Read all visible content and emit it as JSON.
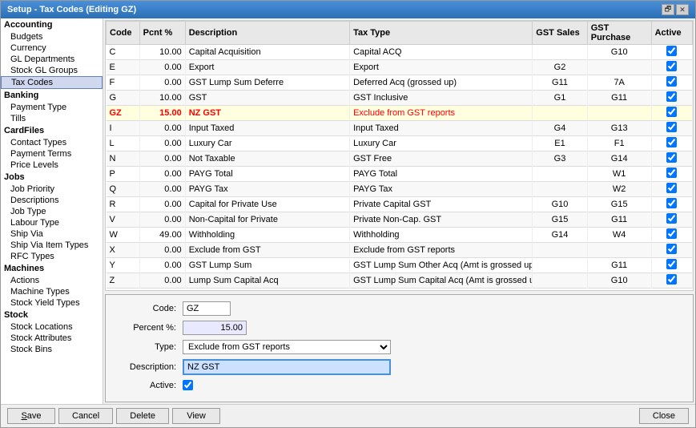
{
  "window": {
    "title": "Setup - Tax Codes (Editing GZ)",
    "restore_btn": "🗗",
    "close_btn": "✕"
  },
  "sidebar": {
    "sections": [
      {
        "header": "Accounting",
        "items": [
          {
            "label": "Budgets",
            "id": "budgets"
          },
          {
            "label": "Currency",
            "id": "currency"
          },
          {
            "label": "GL Departments",
            "id": "gl-departments"
          },
          {
            "label": "Stock GL Groups",
            "id": "stock-gl-groups"
          },
          {
            "label": "Tax Codes",
            "id": "tax-codes",
            "active": true
          }
        ]
      },
      {
        "header": "Banking",
        "items": [
          {
            "label": "Payment Type",
            "id": "payment-type"
          },
          {
            "label": "Tills",
            "id": "tills"
          }
        ]
      },
      {
        "header": "CardFiles",
        "items": [
          {
            "label": "Contact Types",
            "id": "contact-types"
          },
          {
            "label": "Payment Terms",
            "id": "payment-terms"
          },
          {
            "label": "Price Levels",
            "id": "price-levels"
          }
        ]
      },
      {
        "header": "Jobs",
        "items": [
          {
            "label": "Job Priority",
            "id": "job-priority"
          },
          {
            "label": "Descriptions",
            "id": "descriptions"
          },
          {
            "label": "Job Type",
            "id": "job-type"
          },
          {
            "label": "Labour Type",
            "id": "labour-type"
          },
          {
            "label": "Ship Via",
            "id": "ship-via"
          },
          {
            "label": "Ship Via Item Types",
            "id": "ship-via-item-types"
          },
          {
            "label": "RFC Types",
            "id": "rfc-types"
          }
        ]
      },
      {
        "header": "Machines",
        "items": [
          {
            "label": "Actions",
            "id": "actions"
          },
          {
            "label": "Machine Types",
            "id": "machine-types"
          },
          {
            "label": "Stock Yield Types",
            "id": "stock-yield-types"
          }
        ]
      },
      {
        "header": "Stock",
        "items": [
          {
            "label": "Stock Locations",
            "id": "stock-locations"
          },
          {
            "label": "Stock Attributes",
            "id": "stock-attributes"
          },
          {
            "label": "Stock Bins",
            "id": "stock-bins"
          }
        ]
      }
    ]
  },
  "table": {
    "columns": [
      "Code",
      "Pcnt %",
      "Description",
      "Tax Type",
      "GST Sales",
      "GST Purchase",
      "Active"
    ],
    "rows": [
      {
        "code": "C",
        "pcnt": "10.00",
        "desc": "Capital Acquisition",
        "taxtype": "Capital ACQ",
        "gstsales": "",
        "gstpurchase": "G10",
        "active": true,
        "selected": false
      },
      {
        "code": "E",
        "pcnt": "0.00",
        "desc": "Export",
        "taxtype": "Export",
        "gstsales": "G2",
        "gstpurchase": "",
        "active": true,
        "selected": false
      },
      {
        "code": "F",
        "pcnt": "0.00",
        "desc": "GST Lump Sum Deferre",
        "taxtype": "Deferred Acq (grossed up)",
        "gstsales": "G11",
        "gstpurchase": "7A",
        "active": true,
        "selected": false
      },
      {
        "code": "G",
        "pcnt": "10.00",
        "desc": "GST",
        "taxtype": "GST Inclusive",
        "gstsales": "G1",
        "gstpurchase": "G11",
        "active": true,
        "selected": false
      },
      {
        "code": "GZ",
        "pcnt": "15.00",
        "desc": "NZ GST",
        "taxtype": "Exclude from GST reports",
        "gstsales": "",
        "gstpurchase": "",
        "active": true,
        "selected": true
      },
      {
        "code": "I",
        "pcnt": "0.00",
        "desc": "Input Taxed",
        "taxtype": "Input Taxed",
        "gstsales": "G4",
        "gstpurchase": "G13",
        "active": true,
        "selected": false
      },
      {
        "code": "L",
        "pcnt": "0.00",
        "desc": "Luxury Car",
        "taxtype": "Luxury Car",
        "gstsales": "E1",
        "gstpurchase": "F1",
        "active": true,
        "selected": false
      },
      {
        "code": "N",
        "pcnt": "0.00",
        "desc": "Not Taxable",
        "taxtype": "GST Free",
        "gstsales": "G3",
        "gstpurchase": "G14",
        "active": true,
        "selected": false
      },
      {
        "code": "P",
        "pcnt": "0.00",
        "desc": "PAYG Total",
        "taxtype": "PAYG Total",
        "gstsales": "",
        "gstpurchase": "W1",
        "active": true,
        "selected": false
      },
      {
        "code": "Q",
        "pcnt": "0.00",
        "desc": "PAYG Tax",
        "taxtype": "PAYG Tax",
        "gstsales": "",
        "gstpurchase": "W2",
        "active": true,
        "selected": false
      },
      {
        "code": "R",
        "pcnt": "0.00",
        "desc": "Capital for Private Use",
        "taxtype": "Private Capital GST",
        "gstsales": "G10",
        "gstpurchase": "G15",
        "active": true,
        "selected": false
      },
      {
        "code": "V",
        "pcnt": "0.00",
        "desc": "Non-Capital for Private",
        "taxtype": "Private Non-Cap. GST",
        "gstsales": "G15",
        "gstpurchase": "G11",
        "active": true,
        "selected": false
      },
      {
        "code": "W",
        "pcnt": "49.00",
        "desc": "Withholding",
        "taxtype": "Withholding",
        "gstsales": "G14",
        "gstpurchase": "W4",
        "active": true,
        "selected": false
      },
      {
        "code": "X",
        "pcnt": "0.00",
        "desc": "Exclude from GST",
        "taxtype": "Exclude from GST reports",
        "gstsales": "",
        "gstpurchase": "",
        "active": true,
        "selected": false
      },
      {
        "code": "Y",
        "pcnt": "0.00",
        "desc": "GST Lump Sum",
        "taxtype": "GST Lump Sum Other Acq (Amt is grossed up)",
        "gstsales": "",
        "gstpurchase": "G11",
        "active": true,
        "selected": false
      },
      {
        "code": "Z",
        "pcnt": "0.00",
        "desc": "Lump Sum Capital Acq",
        "taxtype": "GST Lump Sum Capital Acq (Amt is grossed up)",
        "gstsales": "",
        "gstpurchase": "G10",
        "active": true,
        "selected": false
      }
    ]
  },
  "edit_panel": {
    "code_label": "Code:",
    "code_value": "GZ",
    "pcnt_label": "Percent %:",
    "pcnt_value": "15.00",
    "type_label": "Type:",
    "type_value": "Exclude from GST reports",
    "type_options": [
      "Exclude from GST reports",
      "GST Inclusive",
      "GST Free",
      "Capital ACQ",
      "Export",
      "Input Taxed",
      "Luxury Car",
      "PAYG Total",
      "PAYG Tax",
      "Private Capital GST",
      "Private Non-Cap. GST",
      "Withholding"
    ],
    "desc_label": "Description:",
    "desc_value": "NZ GST",
    "active_label": "Active:",
    "active_value": true
  },
  "buttons": {
    "save": "Save",
    "cancel": "Cancel",
    "delete": "Delete",
    "view": "View",
    "close": "Close"
  }
}
